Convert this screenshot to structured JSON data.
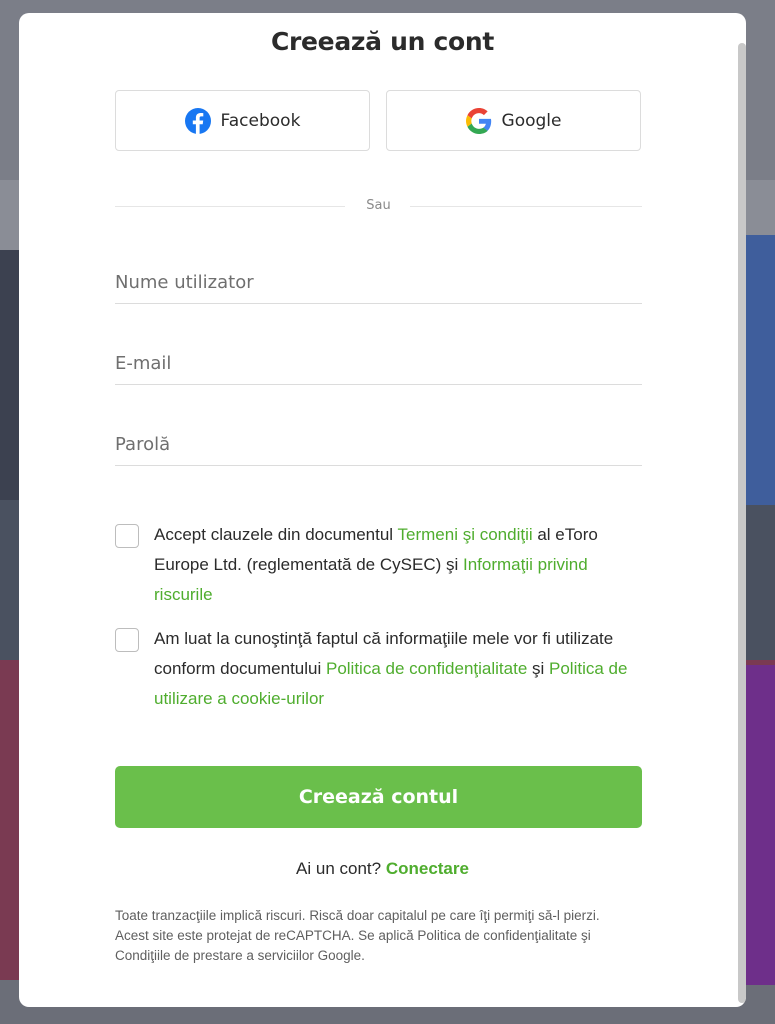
{
  "modal": {
    "title": "Creează un cont"
  },
  "social": {
    "facebook_label": "Facebook",
    "google_label": "Google"
  },
  "divider": {
    "text": "Sau"
  },
  "fields": {
    "username_placeholder": "Nume utilizator",
    "email_placeholder": "E-mail",
    "password_placeholder": "Parolă",
    "username_value": "",
    "email_value": "",
    "password_value": ""
  },
  "terms": {
    "text_1": "Accept clauzele din documentul ",
    "link_terms": "Termeni şi condiţii",
    "text_2": " al eToro Europe Ltd. (reglementată de CySEC) şi ",
    "link_risk": "Informaţii privind riscurile",
    "checked": false
  },
  "privacy": {
    "text_1": "Am luat la cunoştinţă faptul că informaţiile mele vor fi utilizate conform documentului ",
    "link_privacy": "Politica de confidenţialitate",
    "text_2": " şi ",
    "link_cookie": "Politica de utilizare a cookie-urilor",
    "checked": false
  },
  "submit": {
    "label": "Creează contul"
  },
  "login": {
    "prompt": "Ai un cont? ",
    "link": "Conectare"
  },
  "disclaimer": {
    "text": "Toate tranzacţiile implică riscuri. Riscă doar capitalul pe care îţi permiţi să-l pierzi. Acest site este protejat de reCAPTCHA. Se aplică Politica de confidenţialitate şi Condiţiile de prestare a serviciilor Google."
  },
  "colors": {
    "accent": "#6abf4b",
    "link": "#4fad2e",
    "facebook": "#1877f2"
  },
  "icons": {
    "facebook": "facebook-icon",
    "google": "google-icon"
  }
}
